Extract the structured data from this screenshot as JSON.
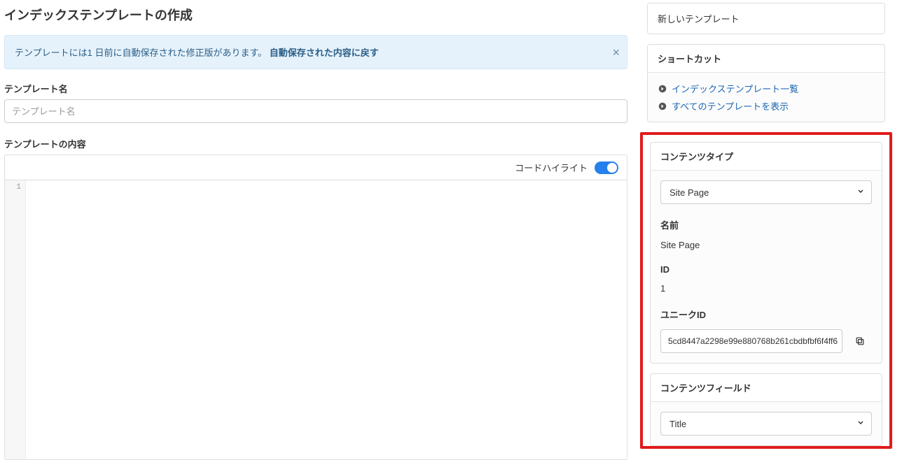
{
  "page": {
    "title": "インデックステンプレートの作成"
  },
  "alert": {
    "message": "テンプレートには1 日前に自動保存された修正版があります。",
    "action": "自動保存された内容に戻す"
  },
  "form": {
    "name_label": "テンプレート名",
    "name_placeholder": "テンプレート名",
    "content_label": "テンプレートの内容",
    "highlight_label": "コードハイライト",
    "line_number": "1"
  },
  "sidebar": {
    "new_template": "新しいテンプレート",
    "shortcuts": {
      "header": "ショートカット",
      "items": [
        "インデックステンプレート一覧",
        "すべてのテンプレートを表示"
      ]
    },
    "content_type": {
      "header": "コンテンツタイプ",
      "selected": "Site Page",
      "name_label": "名前",
      "name_value": "Site Page",
      "id_label": "ID",
      "id_value": "1",
      "unique_id_label": "ユニークID",
      "unique_id_value": "5cd8447a2298e99e880768b261cbdbfbf6f4ff6"
    },
    "content_field": {
      "header": "コンテンツフィールド",
      "selected": "Title"
    }
  }
}
